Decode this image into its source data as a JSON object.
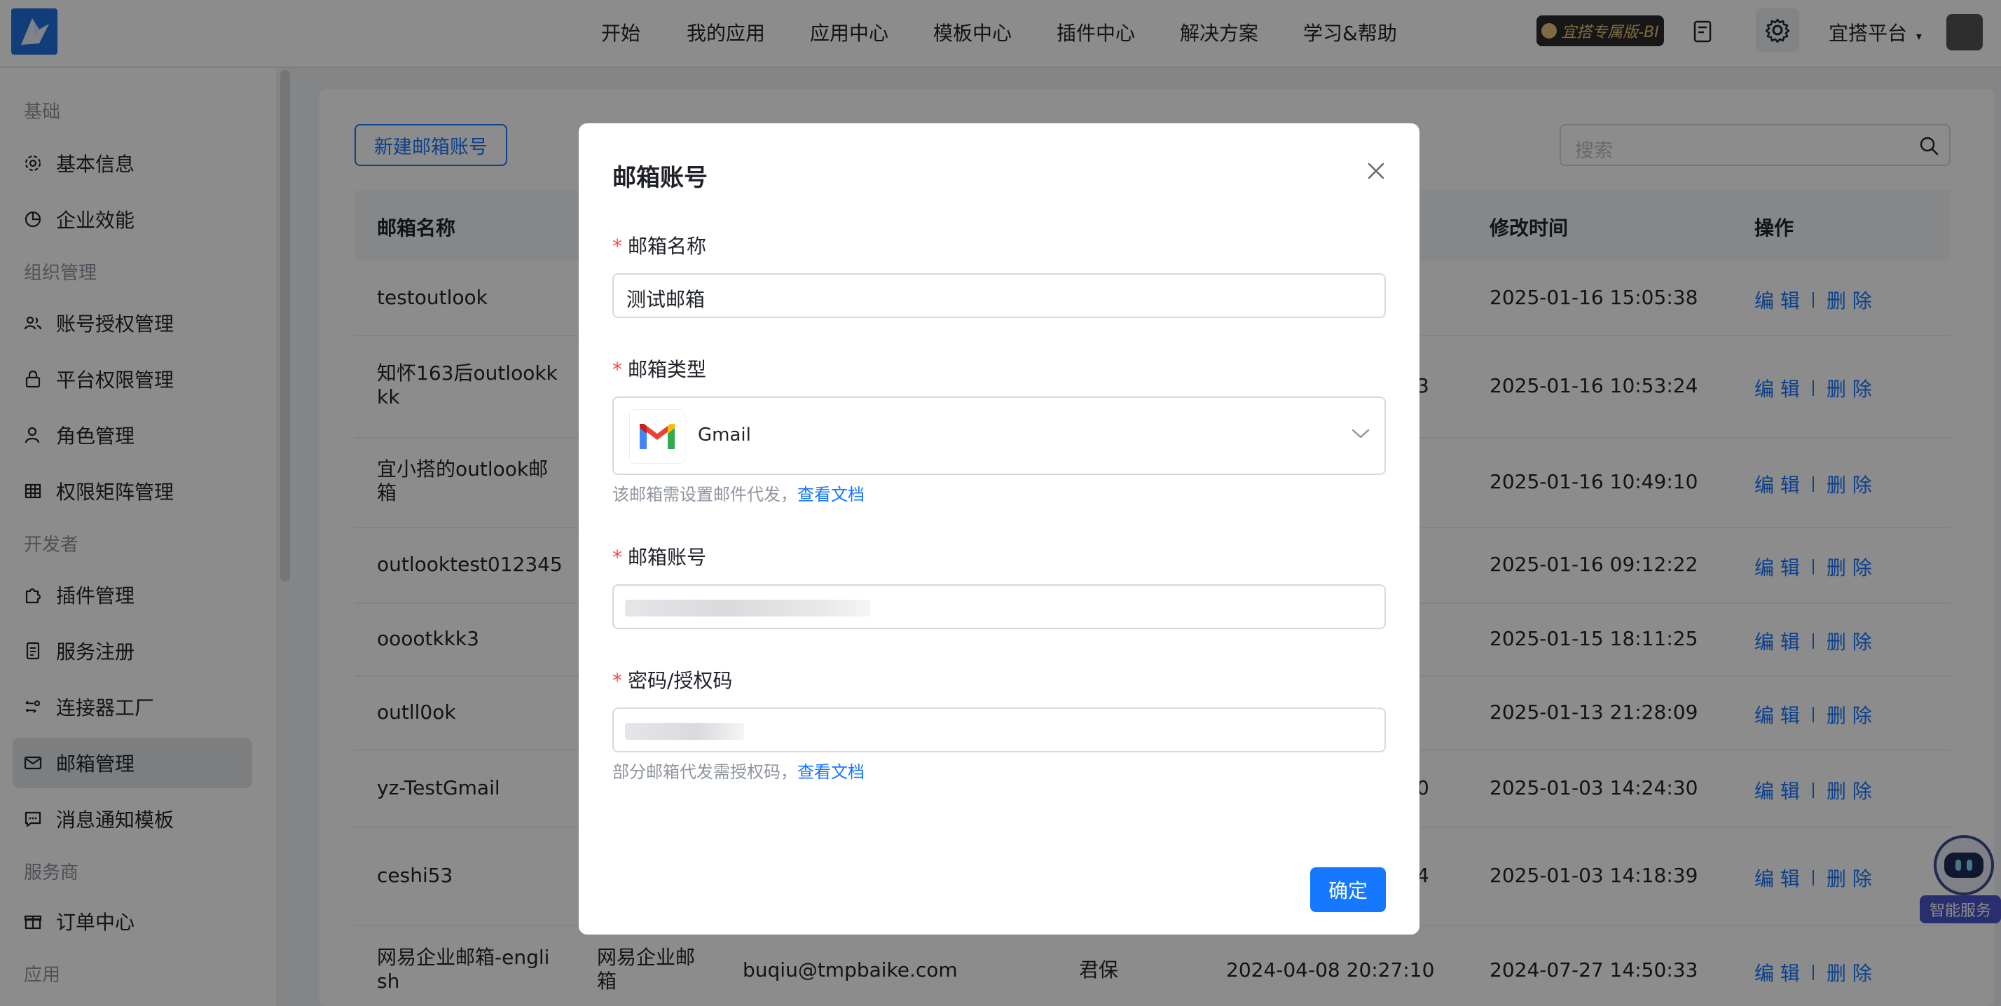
{
  "nav": {
    "items": [
      "开始",
      "我的应用",
      "应用中心",
      "模板中心",
      "插件中心",
      "解决方案",
      "学习&帮助"
    ],
    "vip_badge": "宜搭专属版-BI",
    "platform": "宜搭平台"
  },
  "sidebar": {
    "groups": [
      "基础",
      "组织管理",
      "开发者",
      "服务商",
      "应用"
    ],
    "items": [
      {
        "label": "基本信息",
        "icon": "gear-icon"
      },
      {
        "label": "企业效能",
        "icon": "chart-icon"
      },
      {
        "label": "账号授权管理",
        "icon": "users-icon"
      },
      {
        "label": "平台权限管理",
        "icon": "lock-icon"
      },
      {
        "label": "角色管理",
        "icon": "user-icon"
      },
      {
        "label": "权限矩阵管理",
        "icon": "grid-icon"
      },
      {
        "label": "插件管理",
        "icon": "puzzle-icon"
      },
      {
        "label": "服务注册",
        "icon": "document-icon"
      },
      {
        "label": "连接器工厂",
        "icon": "connector-icon"
      },
      {
        "label": "邮箱管理",
        "icon": "mail-icon"
      },
      {
        "label": "消息通知模板",
        "icon": "message-icon"
      },
      {
        "label": "订单中心",
        "icon": "gift-icon"
      }
    ]
  },
  "toolbar": {
    "new_button": "新建邮箱账号",
    "search_placeholder": "搜索"
  },
  "table": {
    "headers": [
      "邮箱名称",
      "修改时间",
      "操作"
    ],
    "rows": [
      {
        "name": "testoutlook",
        "name2": "",
        "mid": "",
        "mtime": "2025-01-16 15:05:38"
      },
      {
        "name": "知怀163后outlookk",
        "name2": "kk",
        "mid": "3",
        "mtime": "2025-01-16 10:53:24"
      },
      {
        "name": "宜小搭的outlook邮",
        "name2": "箱",
        "mid": "",
        "mtime": "2025-01-16 10:49:10"
      },
      {
        "name": "outlooktest012345",
        "name2": "",
        "mid": "",
        "mtime": "2025-01-16 09:12:22"
      },
      {
        "name": "ooootkkk3",
        "name2": "",
        "mid": "",
        "mtime": "2025-01-15 18:11:25"
      },
      {
        "name": "outll0ok",
        "name2": "",
        "mid": "",
        "mtime": "2025-01-13 21:28:09"
      },
      {
        "name": "yz-TestGmail",
        "name2": "",
        "mid": "0",
        "mtime": "2025-01-03 14:24:30"
      },
      {
        "name": "ceshi53",
        "name2": "",
        "mid": "4",
        "mtime": "2025-01-03 14:18:39"
      }
    ],
    "last_row": {
      "name": "网易企业邮箱-engli",
      "name2": "sh",
      "type": "网易企业邮",
      "type2": "箱",
      "email": "buqiu@tmpbaike.com",
      "creator": "君保",
      "ctime": "2024-04-08 20:27:10",
      "mtime": "2024-07-27 14:50:33"
    },
    "edit_label": "编 辑",
    "delete_label": "删 除"
  },
  "modal": {
    "title": "邮箱账号",
    "name_label": "邮箱名称",
    "name_value": "测试邮箱",
    "type_label": "邮箱类型",
    "type_value": "Gmail",
    "type_hint": "该邮箱需设置邮件代发，",
    "type_hint_link": "查看文档",
    "account_label": "邮箱账号",
    "password_label": "密码/授权码",
    "password_hint": "部分邮箱代发需授权码，",
    "password_hint_link": "查看文档",
    "confirm": "确定"
  },
  "assistant": {
    "label": "智能服务"
  }
}
